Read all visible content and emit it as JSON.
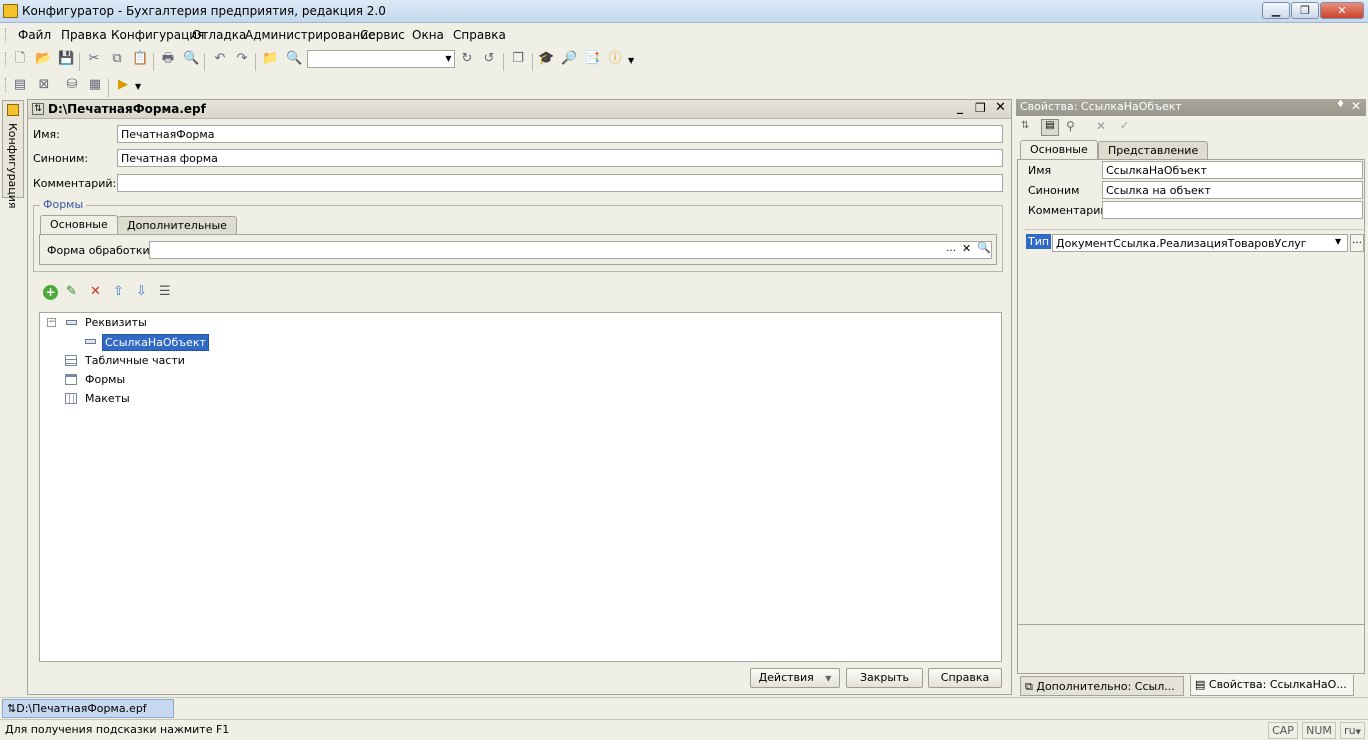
{
  "window": {
    "title": "Конфигуратор - Бухгалтерия предприятия, редакция 2.0"
  },
  "menu": [
    "Файл",
    "Правка",
    "Конфигурация",
    "Отладка",
    "Администрирование",
    "Сервис",
    "Окна",
    "Справка"
  ],
  "left_tab": {
    "label": "Конфигурация"
  },
  "document": {
    "title": "D:\\ПечатнаяФорма.epf",
    "fields": {
      "name_label": "Имя:",
      "name_value": "ПечатнаяФорма",
      "synonym_label": "Синоним:",
      "synonym_value": "Печатная форма",
      "comment_label": "Комментарий:",
      "comment_value": ""
    },
    "forms_group": {
      "title": "Формы",
      "tabs": [
        "Основные",
        "Дополнительные"
      ],
      "processing_form_label": "Форма обработки:",
      "processing_form_value": ""
    },
    "tree": {
      "items": [
        {
          "label": "Реквизиты",
          "icon": "minus-icon",
          "expanded": true
        },
        {
          "label": "СсылкаНаОбъект",
          "icon": "attribute-icon",
          "selected": true
        },
        {
          "label": "Табличные части",
          "icon": "table-icon"
        },
        {
          "label": "Формы",
          "icon": "form-icon"
        },
        {
          "label": "Макеты",
          "icon": "template-icon"
        }
      ]
    },
    "buttons": {
      "actions": "Действия",
      "close": "Закрыть",
      "help": "Справка"
    }
  },
  "properties": {
    "title": "Свойства: СсылкаНаОбъект",
    "tabs": [
      "Основные",
      "Представление"
    ],
    "rows": {
      "name_label": "Имя",
      "name_value": "СсылкаНаОбъект",
      "synonym_label": "Синоним",
      "synonym_value": "Ссылка на объект",
      "comment_label": "Комментарий",
      "comment_value": "",
      "type_label": "Тип",
      "type_value": "ДокументСсылка.РеализацияТоваровУслуг"
    },
    "bottom_tabs": [
      "Дополнительно: Ссыл...",
      "Свойства: СсылкаНаО..."
    ]
  },
  "taskbar": {
    "item": "D:\\ПечатнаяФорма.epf"
  },
  "status": {
    "hint": "Для получения подсказки нажмите F1",
    "cap": "CAP",
    "num": "NUM",
    "lang": "ru"
  },
  "colors": {
    "selection": "#316ac5",
    "title_gradient": "#c5d8ee",
    "panel_title": "#9a988d"
  }
}
